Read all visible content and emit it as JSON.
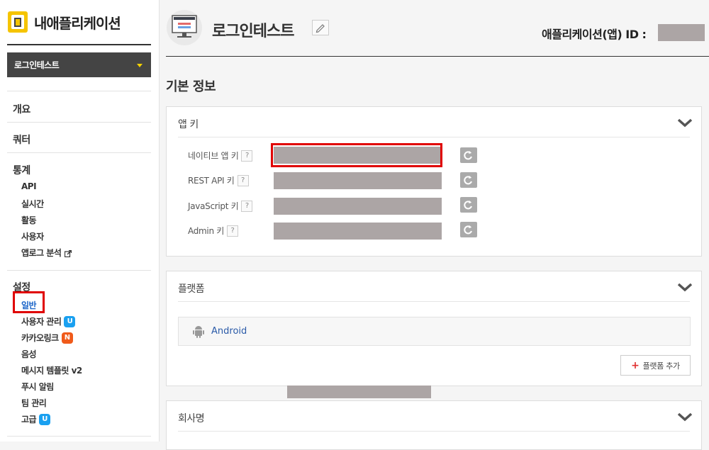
{
  "sidebar": {
    "brand_title": "내애플리케이션",
    "app_selector": "로그인테스트",
    "menu": {
      "overview": "개요",
      "quota": "쿼터",
      "stats": "통계",
      "stats_items": [
        "API",
        "실시간",
        "활동",
        "사용자",
        "앱로그 분석"
      ],
      "settings": "설정",
      "settings_items": [
        {
          "label": "일반"
        },
        {
          "label": "사용자 관리",
          "badge": "U"
        },
        {
          "label": "카카오링크",
          "badge": "N"
        },
        {
          "label": "음성"
        },
        {
          "label": "메시지 템플릿 v2"
        },
        {
          "label": "푸시 알림"
        },
        {
          "label": "팀 관리"
        },
        {
          "label": "고급",
          "badge": "U"
        }
      ]
    }
  },
  "header": {
    "app_name": "로그인테스트",
    "app_id_label": "애플리케이션(앱) ID :"
  },
  "basic_info_title": "기본 정보",
  "app_keys": {
    "title": "앱 키",
    "rows": [
      {
        "label": "네이티브 앱 키",
        "help": "?"
      },
      {
        "label": "REST API 키",
        "help": "?"
      },
      {
        "label": "JavaScript 키",
        "help": "?"
      },
      {
        "label": "Admin 키",
        "help": "?"
      }
    ]
  },
  "platform": {
    "title": "플랫폼",
    "items": [
      "Android"
    ],
    "add_button": "플랫폼 추가"
  },
  "company": {
    "title": "회사명"
  },
  "colors": {
    "highlight": "#e00000",
    "badge_blue": "#1aa0f0",
    "badge_orange": "#f05a1a",
    "link_blue": "#2a5aa8",
    "mask_gray": "#aca5a5"
  }
}
